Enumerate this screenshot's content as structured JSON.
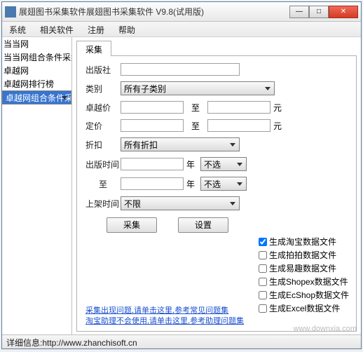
{
  "window": {
    "title": "展翅图书采集软件展翅图书采集软件 V9.8(试用版)"
  },
  "menu": [
    "系统",
    "相关软件",
    "注册",
    "帮助"
  ],
  "sidebar": [
    {
      "label": "当当网",
      "selected": false
    },
    {
      "label": "当当网组合条件采集",
      "selected": false
    },
    {
      "label": "卓越网",
      "selected": false
    },
    {
      "label": "卓越网排行榜",
      "selected": false
    },
    {
      "label": "卓越网组合条件采集",
      "selected": true
    }
  ],
  "tab": "采集",
  "form": {
    "publisher_label": "出版社",
    "category_label": "类别",
    "category_value": "所有子类别",
    "zyprice_label": "卓越价",
    "to_label": "至",
    "unit_yuan": "元",
    "fixprice_label": "定价",
    "discount_label": "折扣",
    "discount_value": "所有折扣",
    "pubtime_label": "出版时间",
    "year_label": "年",
    "year_sel": "不选",
    "shelf_label": "上架时间",
    "shelf_value": "不限"
  },
  "buttons": {
    "collect": "采集",
    "settings": "设置"
  },
  "checks": [
    {
      "label": "生成淘宝数据文件",
      "checked": true
    },
    {
      "label": "生成拍拍数据文件",
      "checked": false
    },
    {
      "label": "生成易趣数据文件",
      "checked": false
    },
    {
      "label": "生成Shopex数据文件",
      "checked": false
    },
    {
      "label": "生成EcShop数据文件",
      "checked": false
    },
    {
      "label": "生成Excel数据文件",
      "checked": false
    }
  ],
  "links": [
    "采集出现问题,请单击这里,参考常见问题集",
    "淘宝助理不会使用,请单击这里,参考助理问题集"
  ],
  "status": "详细信息:http://www.zhanchisoft.cn",
  "watermark": "www.downxia.com"
}
